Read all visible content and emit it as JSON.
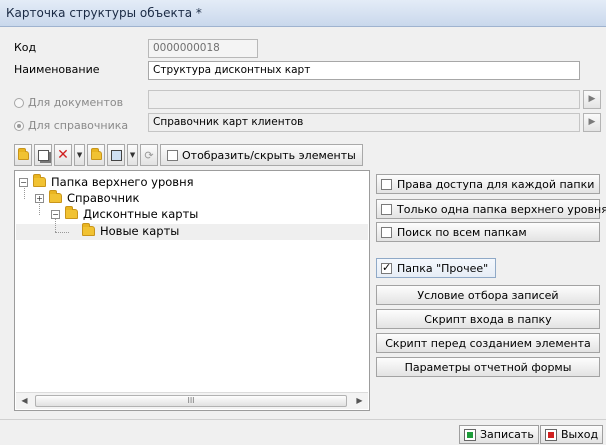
{
  "window": {
    "title": "Карточка структуры объекта *"
  },
  "form": {
    "code_label": "Код",
    "code_value": "0000000018",
    "name_label": "Наименование",
    "name_value": "Структура дисконтных карт",
    "radio_documents_label": "Для документов",
    "radio_documents_value": "",
    "radio_reference_label": "Для справочника",
    "radio_reference_value": "Справочник карт клиентов",
    "selected_radio": "reference"
  },
  "toolbar": {
    "toggle_elements_label": "Отобразить/скрыть элементы",
    "toggle_elements_checked": false
  },
  "tree": {
    "nodes": [
      {
        "label": "Папка верхнего уровня",
        "expander": "−"
      },
      {
        "label": "Справочник",
        "expander": "+"
      },
      {
        "label": "Дисконтные карты",
        "expander": "−"
      },
      {
        "label": "Новые карты",
        "expander": ""
      }
    ],
    "selected_index": 3,
    "scroll_thumb_glyph": "III"
  },
  "options": {
    "access_rights_label": "Права доступа для каждой папки",
    "access_rights_checked": false,
    "single_top_label": "Только одна папка верхнего уровня",
    "single_top_checked": false,
    "search_all_label": "Поиск по всем папкам",
    "search_all_checked": false,
    "other_folder_label": "Папка \"Прочее\"",
    "other_folder_checked": true
  },
  "actions": {
    "filter_condition": "Условие отбора записей",
    "enter_script": "Скрипт входа в папку",
    "before_create_script": "Скрипт перед созданием элемента",
    "report_params": "Параметры отчетной формы"
  },
  "footer": {
    "save_label": "Записать",
    "exit_label": "Выход"
  },
  "colors": {
    "folder": "#f1c232",
    "delete": "#d02020",
    "save": "#1e9c3a",
    "titlebar": "#c9d8ec"
  }
}
